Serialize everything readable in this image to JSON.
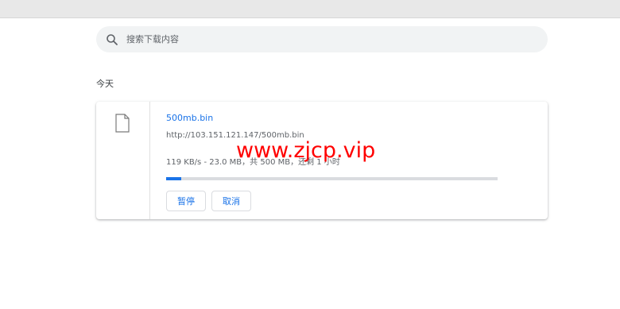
{
  "search": {
    "placeholder": "搜索下载内容",
    "icon": "search-icon"
  },
  "section": {
    "title": "今天"
  },
  "download": {
    "file_name": "500mb.bin",
    "url": "http://103.151.121.147/500mb.bin",
    "status": "119 KB/s - 23.0 MB，共 500 MB，还剩 1 小时",
    "progress_fraction": 0.046,
    "file_icon": "file-icon",
    "pause_label": "暂停",
    "cancel_label": "取消"
  },
  "watermark": {
    "text": "www.zjcp.vip"
  },
  "colors": {
    "accent": "#1a73e8",
    "watermark": "#ff0000",
    "search_bg": "#f1f3f4"
  }
}
